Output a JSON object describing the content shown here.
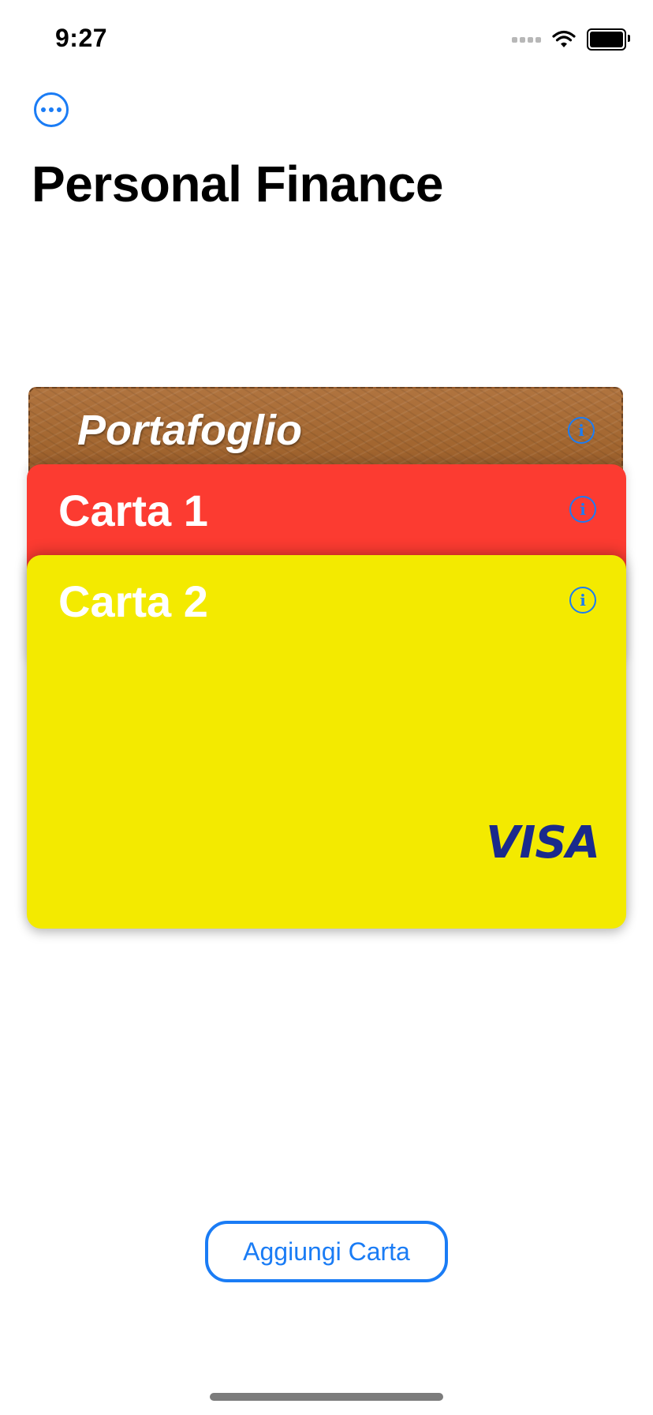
{
  "status_bar": {
    "time": "9:27"
  },
  "header": {
    "title": "Personal Finance"
  },
  "cards": {
    "wallet": {
      "title": "Portafoglio",
      "info_icon": "info-icon"
    },
    "card1": {
      "title": "Carta 1",
      "color": "#fc3b31",
      "info_icon": "info-icon"
    },
    "card2": {
      "title": "Carta 2",
      "color": "#f3ea00",
      "brand": "VISA",
      "info_icon": "info-icon"
    }
  },
  "actions": {
    "add_card_label": "Aggiungi Carta"
  },
  "colors": {
    "accent": "#1a7cf5",
    "visa": "#1a2a8c"
  }
}
